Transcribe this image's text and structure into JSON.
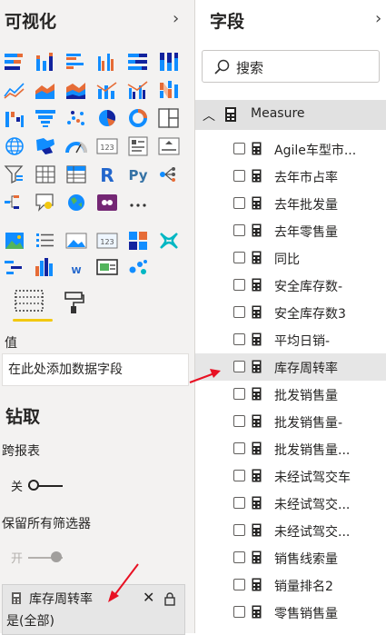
{
  "visualizations": {
    "title": "可视化",
    "values_label": "值",
    "values_placeholder": "在此处添加数据字段",
    "drillthrough_title": "钻取",
    "cross_report_label": "跨报表",
    "cross_report_state": "关",
    "keep_filters_label": "保留所有筛选器",
    "keep_filters_state": "开",
    "filter_card": {
      "field": "库存周转率",
      "state": "是(全部)"
    }
  },
  "fields": {
    "title": "字段",
    "search_placeholder": "搜索",
    "table": "Measure",
    "items": [
      "Agile车型市...",
      "去年市占率",
      "去年批发量",
      "去年零售量",
      "同比",
      "安全库存数-",
      "安全库存数3",
      "平均日销-",
      "库存周转率",
      "批发销售量",
      "批发销售量-",
      "批发销售量...",
      "未经试驾交车",
      "未经试驾交...",
      "未经试驾交...",
      "销售线索量",
      "销量排名2",
      "零售销售量"
    ],
    "selected_index": 8
  },
  "colors": {
    "accent": "#f2c811",
    "arrow": "#e81123",
    "icon_blue": "#118dff",
    "icon_orange": "#e66c37",
    "icon_dark": "#12239e"
  }
}
